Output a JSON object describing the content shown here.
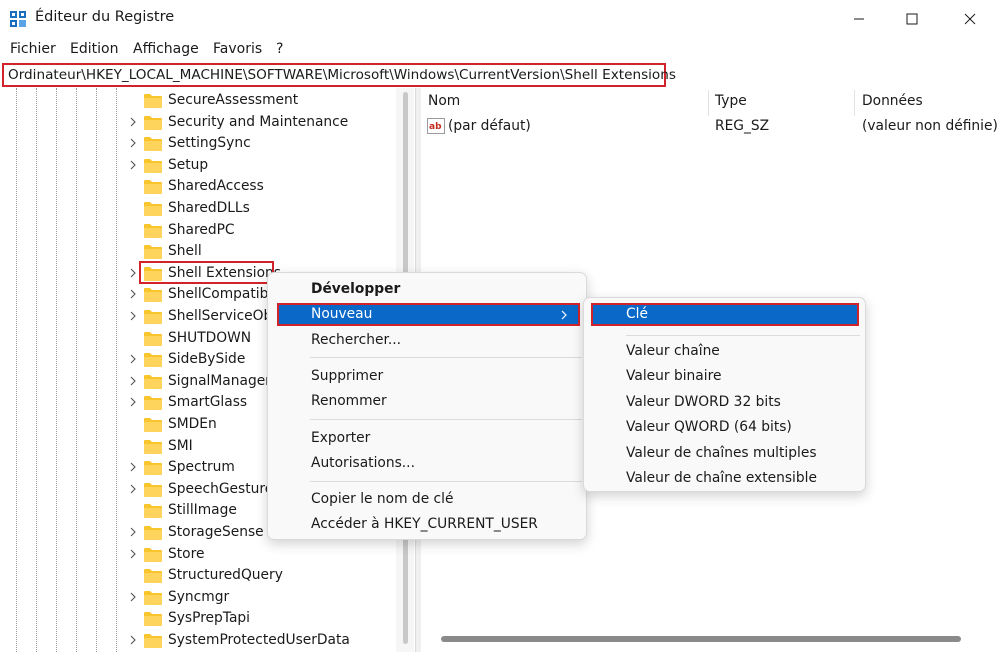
{
  "window": {
    "title": "Éditeur du Registre",
    "app_icon": "regedit-icon"
  },
  "menubar": {
    "items": [
      "Fichier",
      "Edition",
      "Affichage",
      "Favoris",
      "?"
    ]
  },
  "address": {
    "path": "Ordinateur\\HKEY_LOCAL_MACHINE\\SOFTWARE\\Microsoft\\Windows\\CurrentVersion\\Shell Extensions"
  },
  "tree": {
    "items": [
      "SecureAssessment",
      "Security and Maintenance",
      "SettingSync",
      "Setup",
      "SharedAccess",
      "SharedDLLs",
      "SharedPC",
      "Shell",
      "Shell Extensions",
      "ShellCompatibi",
      "ShellServiceObj",
      "SHUTDOWN",
      "SideBySide",
      "SignalManager",
      "SmartGlass",
      "SMDEn",
      "SMI",
      "Spectrum",
      "SpeechGestures",
      "StillImage",
      "StorageSense",
      "Store",
      "StructuredQuery",
      "Syncmgr",
      "SysPrepTapi",
      "SystemProtectedUserData"
    ],
    "selected": "Shell Extensions"
  },
  "list": {
    "headers": {
      "name": "Nom",
      "type": "Type",
      "data": "Données"
    },
    "rows": [
      {
        "name": "(par défaut)",
        "type": "REG_SZ",
        "data": "(valeur non définie)"
      }
    ]
  },
  "context_menu": {
    "developper": "Développer",
    "nouveau": "Nouveau",
    "rechercher": "Rechercher...",
    "supprimer": "Supprimer",
    "renommer": "Renommer",
    "exporter": "Exporter",
    "autorisations": "Autorisations...",
    "copier": "Copier le nom de clé",
    "acceder": "Accéder à HKEY_CURRENT_USER"
  },
  "submenu": {
    "cle": "Clé",
    "chaine": "Valeur chaîne",
    "binaire": "Valeur binaire",
    "dword": "Valeur DWORD 32 bits",
    "qword": "Valeur QWORD (64 bits)",
    "multi": "Valeur de chaînes multiples",
    "extensible": "Valeur de chaîne extensible"
  },
  "colors": {
    "highlight": "#0a69c8",
    "annotation": "#d2232a",
    "folder": "#f8c62c"
  }
}
